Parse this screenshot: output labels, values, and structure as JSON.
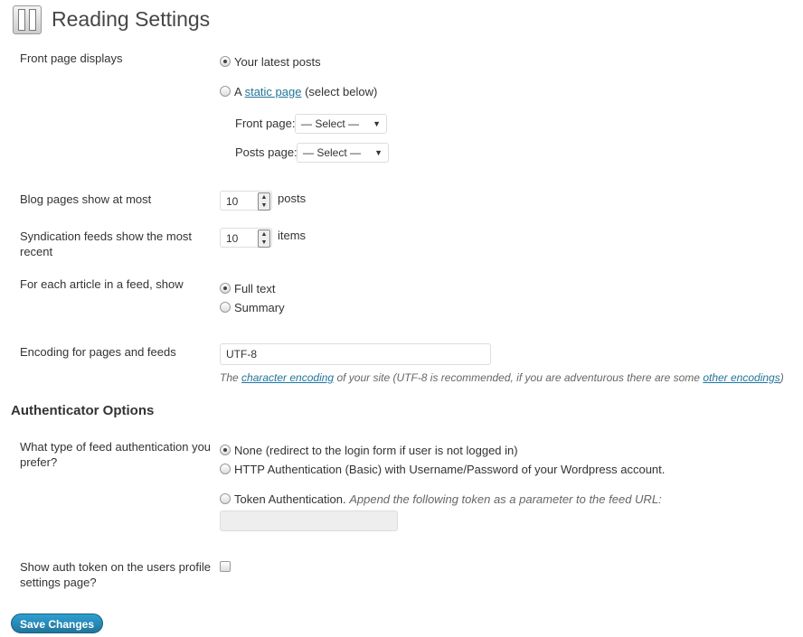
{
  "title": "Reading Settings",
  "front": {
    "label": "Front page displays",
    "opt1": "Your latest posts",
    "opt2_pre": "A",
    "opt2_link": "static page",
    "opt2_post": "(select below)",
    "front_label": "Front page:",
    "posts_label": "Posts page:",
    "select_value": "— Select —"
  },
  "blog": {
    "label": "Blog pages show at most",
    "value": "10",
    "unit": "posts"
  },
  "synd": {
    "label1": "Syndication feeds show the most",
    "label2": "recent",
    "value": "10",
    "unit": "items"
  },
  "feed": {
    "label": "For each article in a feed, show",
    "opt1": "Full text",
    "opt2": "Summary"
  },
  "enc": {
    "label": "Encoding for pages and feeds",
    "value": "UTF-8",
    "d1": "The",
    "link1": "character encoding",
    "d2": "of your site (UTF-8 is recommended, if you are adventurous there are some",
    "link2": "other encodings",
    "d3": ")"
  },
  "auth": {
    "heading": "Authenticator Options",
    "label1": "What type of feed authentication you",
    "label2": "prefer?",
    "opt1": "None (redirect to the login form if user is not logged in)",
    "opt2": "HTTP Authentication (Basic) with Username/Password of your Wordpress account.",
    "opt3": "Token Authentication.",
    "opt3_desc": "Append the following token as a parameter to the feed URL:",
    "token": ""
  },
  "show": {
    "label1": "Show auth token on the users profile",
    "label2": "settings page?",
    "checked": false
  },
  "save": "Save Changes"
}
